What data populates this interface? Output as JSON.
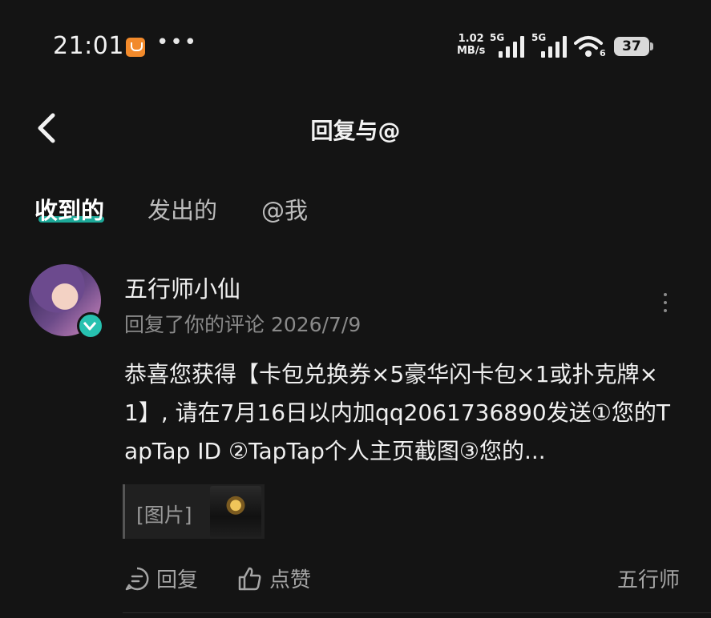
{
  "status_bar": {
    "time": "21:01",
    "net_speed_value": "1.02",
    "net_speed_unit": "MB/s",
    "sim1_label": "5G",
    "sim2_label": "5G",
    "wifi_sub": "6",
    "battery": "37"
  },
  "header": {
    "title": "回复与@"
  },
  "tabs": [
    {
      "label": "收到的",
      "active": true
    },
    {
      "label": "发出的",
      "active": false
    },
    {
      "label": "@我",
      "active": false
    }
  ],
  "comment": {
    "username": "五行师小仙",
    "meta": "回复了你的评论 2026/7/9",
    "content": "恭喜您获得【卡包兑换券×5豪华闪卡包×1或扑克牌×1】, 请在7月16日以内加qq2061736890发送①您的TapTap ID ②TapTap个人主页截图③您的...",
    "quote_label": "[图片]",
    "actions": {
      "reply": "回复",
      "like": "点赞"
    },
    "source": "五行师"
  },
  "colors": {
    "background": "#141414",
    "accent": "#1ec3b0",
    "secondary_text": "#8a8a8a"
  }
}
